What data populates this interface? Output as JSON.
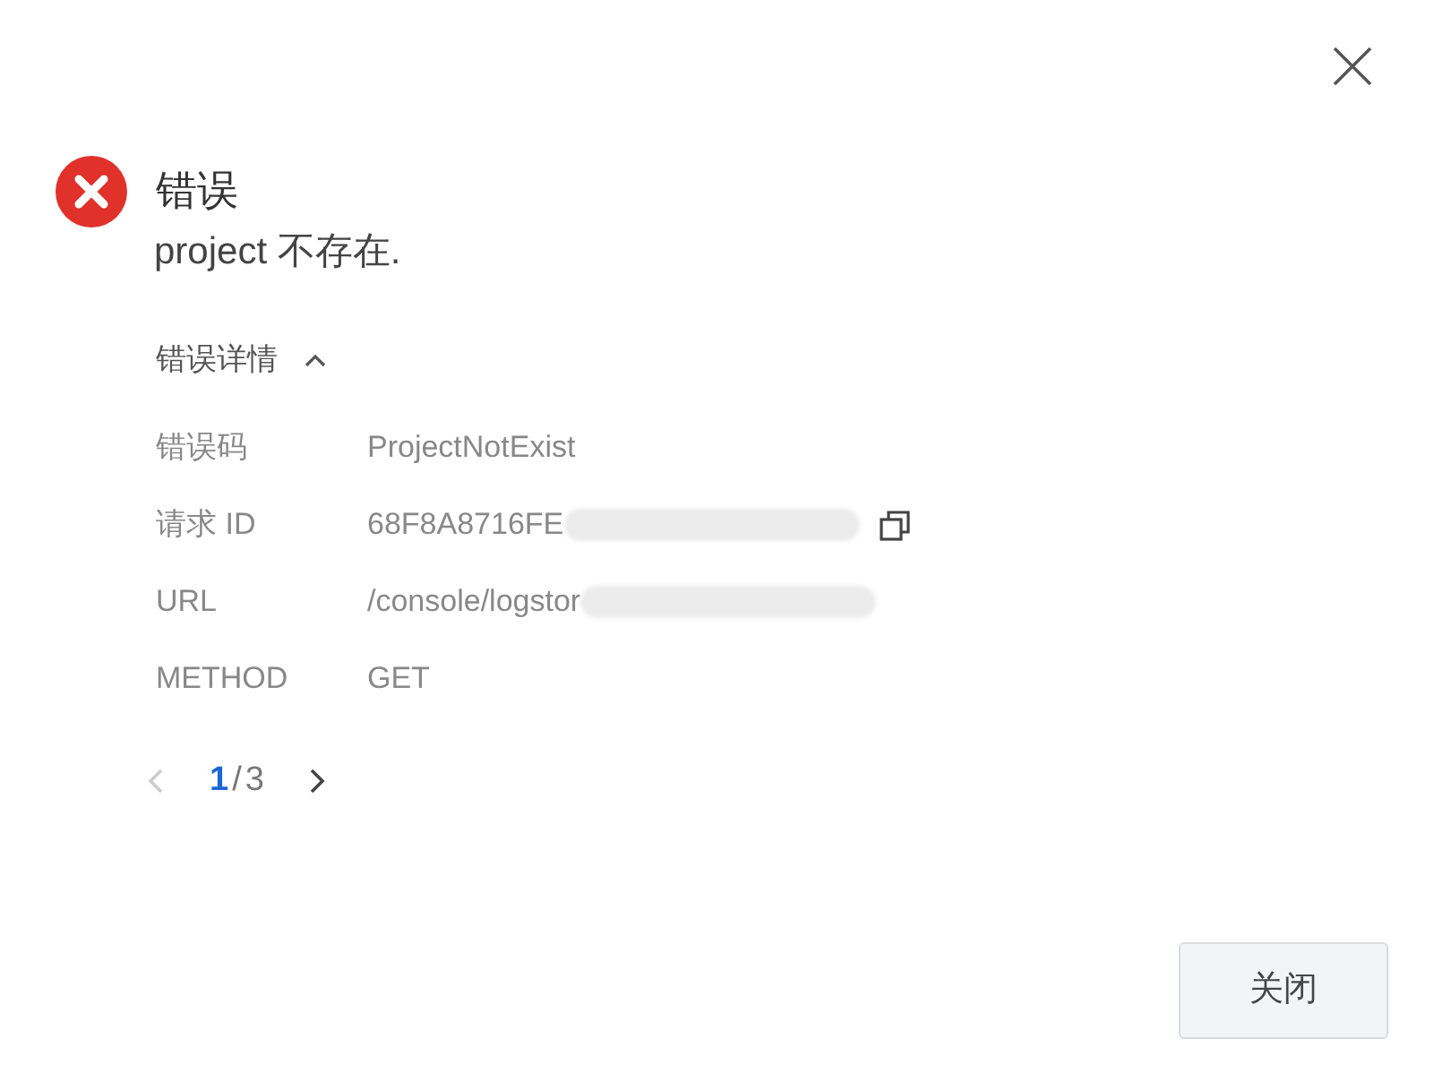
{
  "dialog": {
    "title": "错误",
    "message": "project 不存在.",
    "details": {
      "label": "错误详情",
      "expanded": true,
      "rows": [
        {
          "label": "错误码",
          "value": "ProjectNotExist",
          "redacted": false,
          "copyable": false
        },
        {
          "label": "请求 ID",
          "value": "68F8A8716FE",
          "redacted": true,
          "copyable": true
        },
        {
          "label": "URL",
          "value": "/console/logstor",
          "redacted": true,
          "copyable": false
        },
        {
          "label": "METHOD",
          "value": "GET",
          "redacted": false,
          "copyable": false
        }
      ]
    },
    "pagination": {
      "current": "1",
      "separator": "/",
      "total": "3",
      "prev_disabled": true,
      "next_disabled": false
    },
    "buttons": [
      "关闭"
    ]
  }
}
